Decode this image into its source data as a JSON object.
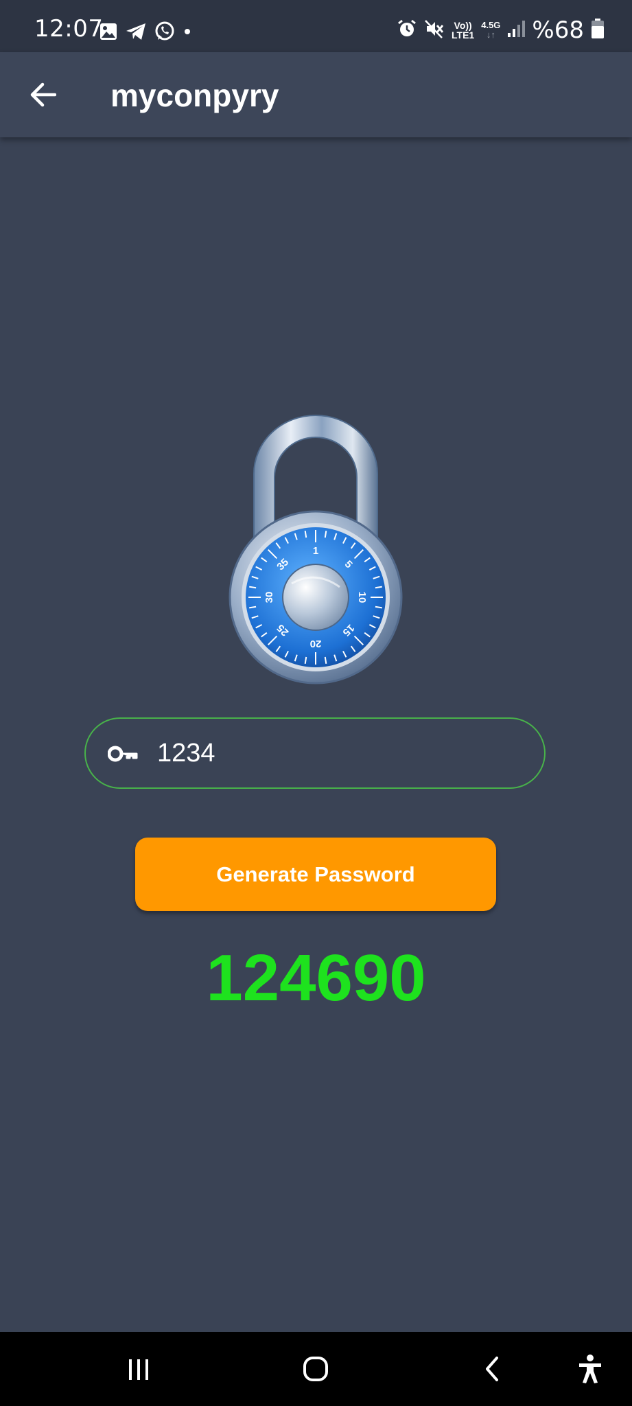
{
  "status_bar": {
    "time": "12:07",
    "battery": "%68",
    "left_icons": [
      "gallery-icon",
      "telegram-icon",
      "whatsapp-icon",
      "dot-icon"
    ],
    "right_icons": [
      "alarm-icon",
      "mute-icon",
      "volte-icon",
      "network-4.5g-icon",
      "signal-icon",
      "battery-icon"
    ],
    "volte_label": "Vo))",
    "lte_label": "LTE1",
    "network_label": "4.5G"
  },
  "app_bar": {
    "title": "myconpyry",
    "back_icon": "arrow-left-icon"
  },
  "lock": {
    "dial_numbers": [
      "1",
      "5",
      "10",
      "15",
      "20",
      "25",
      "30",
      "35"
    ]
  },
  "pin_field": {
    "icon": "key-icon",
    "value": "1234"
  },
  "generate_button": {
    "label": "Generate Password",
    "color": "#ff9800"
  },
  "result": {
    "value": "124690",
    "color": "#1ee21e"
  },
  "nav_bar": {
    "items": [
      "recents-icon",
      "home-icon",
      "back-icon",
      "accessibility-icon"
    ]
  }
}
